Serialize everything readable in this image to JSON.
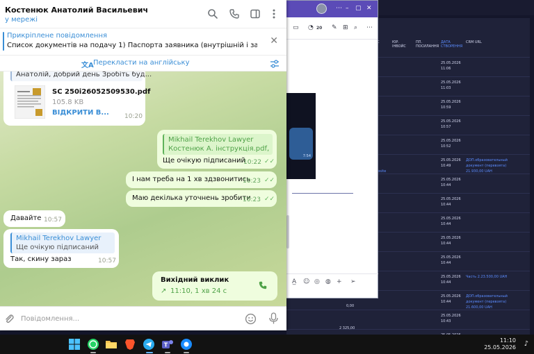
{
  "crm": {
    "headers": [
      {
        "label": "С",
        "link": false
      },
      {
        "label": "ЮР. ІНВОЙС",
        "link": false
      },
      {
        "label": "ПП. ПОСИЛАННЯ",
        "link": false
      },
      {
        "label": "ДАТА СТВОРЕННЯ",
        "link": true
      },
      {
        "label": "CRM URL",
        "link": false
      }
    ],
    "rows": [
      {
        "date": "25.05.2026",
        "time": "11:06",
        "note": ""
      },
      {
        "date": "25.05.2026",
        "time": "11:03",
        "note": ""
      },
      {
        "date": "25.05.2026",
        "time": "10:59",
        "note": ""
      },
      {
        "date": "25.05.2026",
        "time": "10:57",
        "note": ""
      },
      {
        "date": "25.05.2026",
        "time": "10:52",
        "note": ""
      },
      {
        "date": "25.05.2026",
        "time": "10:49",
        "note": "ДОП.образовательный документ (перевзята) 21.930,00 UAH"
      },
      {
        "date": "25.05.2026",
        "time": "10:44",
        "note": ""
      },
      {
        "date": "25.05.2026",
        "time": "10:44",
        "note": ""
      },
      {
        "date": "25.05.2026",
        "time": "10:44",
        "note": ""
      },
      {
        "date": "25.05.2026",
        "time": "10:44",
        "note": ""
      },
      {
        "date": "25.05.2026",
        "time": "10:44",
        "note": ""
      },
      {
        "date": "25.05.2026",
        "time": "10:44",
        "note": "Часть 2.23.500,00 UAH"
      },
      {
        "date": "25.05.2026",
        "time": "10:44",
        "note": "ДОП.образовательный документ (перевзята) 21.600,00 UAH"
      },
      {
        "date": "25.05.2026",
        "time": "10:43",
        "note": ""
      },
      {
        "date": "25.05.2026",
        "time": "10:42",
        "note": ""
      }
    ],
    "amounts": [
      "0,00",
      "2 325,00"
    ],
    "link_fragment": "ebsite"
  },
  "mid": {
    "count": "20",
    "video_time": "7:54"
  },
  "chat": {
    "name": "Костенюк Анатолий Васильевич",
    "status": "у мережі",
    "pinned_title": "Прикріплене повідомлення",
    "pinned_text": "Список документів на подачу  1) Паспорта заявника (внутрішній і закордо...",
    "translate": "Перекласти на англійську",
    "input_placeholder": "Повідомлення...",
    "messages": {
      "m1_text": "Анатолій, добрий день Зробіть буд...",
      "file_name": "SC 250i26052509530.pdf",
      "file_size": "105.8 KB",
      "file_open": "ВІДКРИТИ В...",
      "m1_time": "10:20",
      "m2_reply_name": "Mikhail Terekhov Lawyer",
      "m2_reply_text": "Костенюк А. інструкція.pdf, О...",
      "m2_text": "Ще очікую підписаний",
      "m2_time": "10:22",
      "m3_text": "І нам треба на 1 хв здзвонитись",
      "m3_time": "10:23",
      "m4_text": "Маю декілька уточнень зробити",
      "m4_time": "10:23",
      "m5_text": "Давайте",
      "m5_time": "10:57",
      "m6_reply_name": "Mikhail Terekhov Lawyer",
      "m6_reply_text": "Ще очікую підписаний",
      "m6_text": "Так, скину зараз",
      "m6_time": "10:57",
      "call_title": "Вихідний виклик",
      "call_info": "11:10, 1 хв 24 с"
    }
  },
  "taskbar": {
    "time": "11:10",
    "date": "25.05.2026"
  }
}
